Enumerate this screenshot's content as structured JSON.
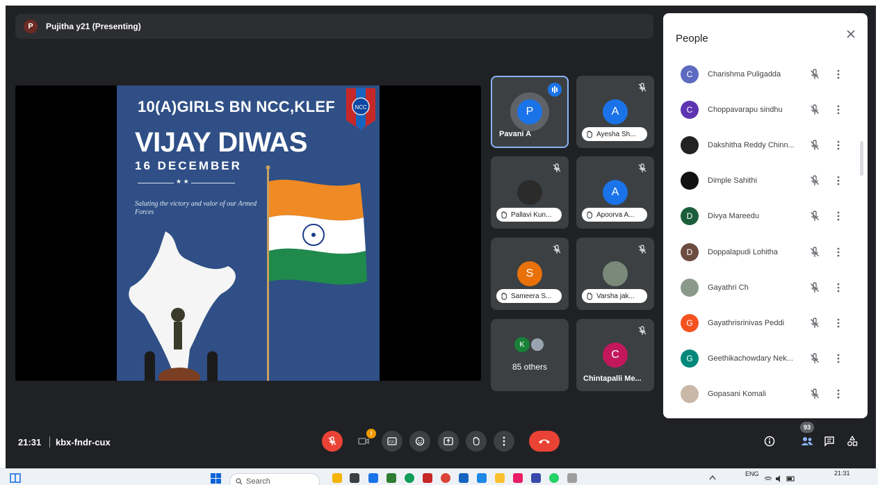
{
  "presenter": {
    "initial": "P",
    "label": "Pujitha y21 (Presenting)"
  },
  "poster": {
    "unit": "10(A)GIRLS BN NCC,KLEF",
    "title": "VIJAY DIWAS",
    "date": "16 DECEMBER",
    "stars": "★ ★",
    "subtitle": "Saluting the victory and valor of our Armed Forces",
    "badge_text": "NCC"
  },
  "tiles": [
    {
      "initial": "P",
      "name": "Pavani A",
      "color": "#1a73e8",
      "speaking": true
    },
    {
      "initial": "A",
      "name": "Ayesha Sh...",
      "color": "#1a73e8",
      "hand": true
    },
    {
      "initial": "",
      "name": "Pallavi Kun...",
      "color": "#2b2b2b",
      "hand": true,
      "photo": true
    },
    {
      "initial": "A",
      "name": "Apoorva A...",
      "color": "#1a73e8",
      "hand": true
    },
    {
      "initial": "S",
      "name": "Sameera S...",
      "color": "#e8710a",
      "hand": true
    },
    {
      "initial": "",
      "name": "Varsha jak...",
      "color": "#7a8a7a",
      "hand": true,
      "photo": true
    },
    {
      "initial": "K",
      "name": "85 others",
      "color": "#188038"
    },
    {
      "initial": "C",
      "name": "Chintapalli Me...",
      "color": "#c2185b"
    }
  ],
  "people_panel": {
    "title": "People",
    "participants": [
      {
        "initial": "C",
        "name": "Charishma Puligadda",
        "color": "#5c6bc0"
      },
      {
        "initial": "C",
        "name": "Choppavarapu sindhu",
        "color": "#5e35b1"
      },
      {
        "initial": "",
        "name": "Dakshitha Reddy Chinn...",
        "color": "#222222"
      },
      {
        "initial": "",
        "name": "Dimple Sahithi",
        "color": "#111111"
      },
      {
        "initial": "D",
        "name": "Divya Mareedu",
        "color": "#1b5e3b"
      },
      {
        "initial": "D",
        "name": "Doppalapudi Lohitha",
        "color": "#6d4c41"
      },
      {
        "initial": "",
        "name": "Gayathri Ch",
        "color": "#8a9a8a"
      },
      {
        "initial": "G",
        "name": "Gayathrisrinivas Peddi",
        "color": "#f4511e"
      },
      {
        "initial": "G",
        "name": "Geethikachowdary Nek...",
        "color": "#00897b"
      },
      {
        "initial": "",
        "name": "Gopasani Komali",
        "color": "#c9b8a8"
      }
    ]
  },
  "meeting": {
    "time": "21:31",
    "code": "kbx-fndr-cux",
    "participants_count": "93"
  },
  "taskbar": {
    "search_placeholder": "Search",
    "lang": "ENG",
    "time": "21:31"
  },
  "colors": {
    "meet_bg": "#202124",
    "accent": "#8ab4f8",
    "end_call": "#ea4335"
  }
}
